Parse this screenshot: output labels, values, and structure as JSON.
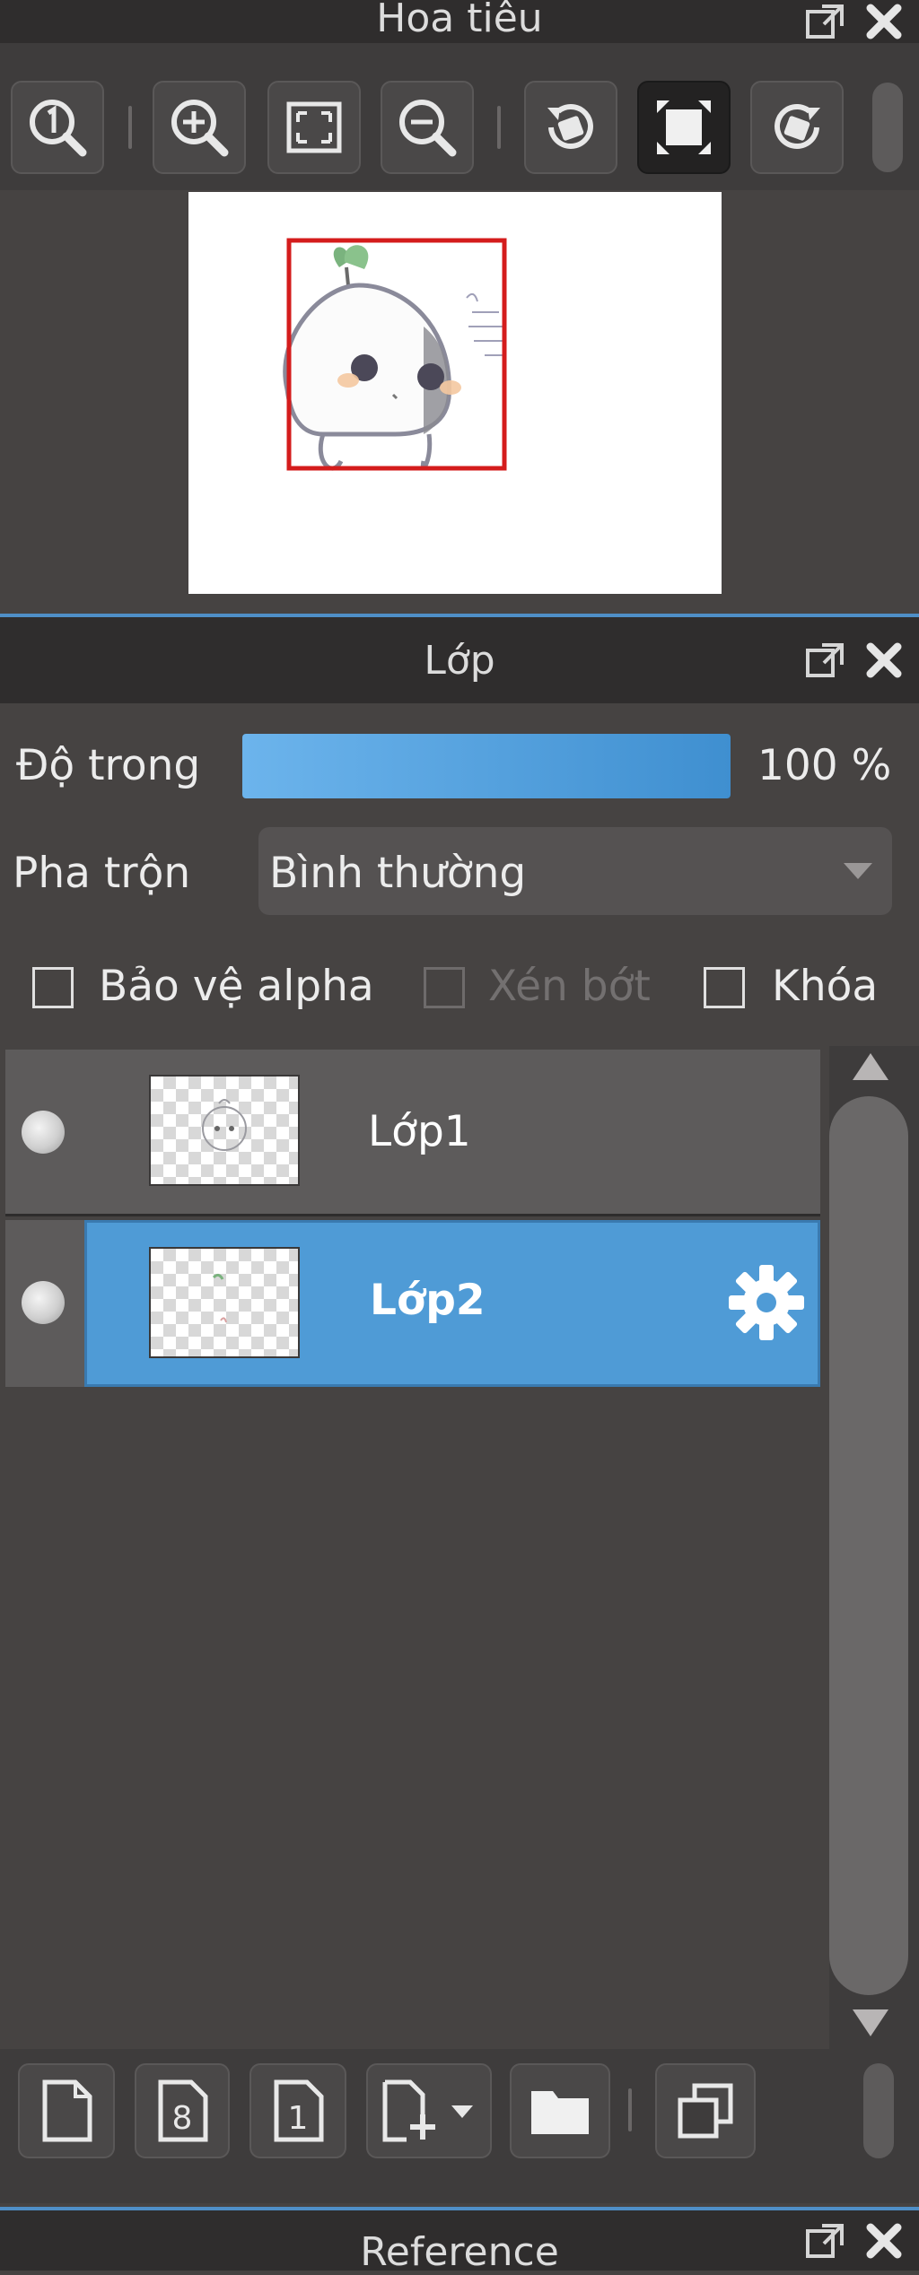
{
  "navigator": {
    "title": "Hoa tiêu",
    "toolbar": [
      {
        "icon": "zoom-actual-icon"
      },
      {
        "icon": "zoom-in-icon"
      },
      {
        "icon": "fit-screen-icon"
      },
      {
        "icon": "zoom-out-icon"
      },
      {
        "icon": "rotate-left-icon"
      },
      {
        "icon": "fullscreen-icon",
        "active": true
      },
      {
        "icon": "rotate-right-icon"
      }
    ]
  },
  "layers": {
    "title": "Lớp",
    "opacity_label": "Độ trong",
    "opacity_value": "100 %",
    "opacity_fraction": 1.0,
    "blend_label": "Pha trộn",
    "blend_value": "Bình thường",
    "protect_alpha_label": "Bảo vệ alpha",
    "clipping_label": "Xén bớt",
    "lock_label": "Khóa",
    "items": [
      {
        "name": "Lớp1",
        "selected": false
      },
      {
        "name": "Lớp2",
        "selected": true
      }
    ],
    "bottom_toolbar": [
      "new-layer-icon",
      "layer-8bit-icon",
      "layer-1bit-icon",
      "add-layer-menu-icon",
      "folder-icon",
      "duplicate-icon"
    ]
  },
  "reference": {
    "title": "Reference"
  },
  "colors": {
    "accent": "#4f9bd6",
    "selection_red": "#d41c1c",
    "panel_bg": "#464342",
    "header_bg": "#2f2d2d"
  }
}
